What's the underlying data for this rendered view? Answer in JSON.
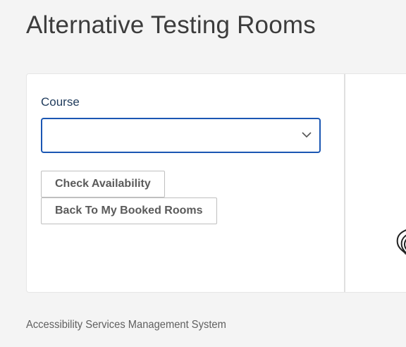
{
  "page": {
    "title": "Alternative Testing Rooms"
  },
  "form": {
    "course_label": "Course",
    "course_value": "",
    "icons": {
      "dropdown": "chevron-down-icon"
    }
  },
  "buttons": {
    "check_availability": "Check Availability",
    "back_to_booked": "Back To My Booked Rooms"
  },
  "footer": {
    "text": "Accessibility Services Management System"
  },
  "colors": {
    "select_border": "#1b57b3",
    "label": "#1f3b5c",
    "background": "#f4f4f4"
  }
}
